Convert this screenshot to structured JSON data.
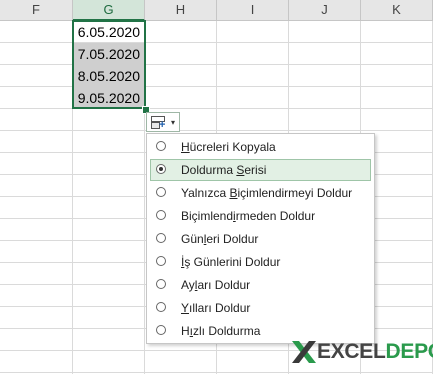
{
  "columns": [
    "F",
    "G",
    "H",
    "I",
    "J",
    "K"
  ],
  "cells": [
    {
      "value": "6.05.2020"
    },
    {
      "value": "7.05.2020"
    },
    {
      "value": "8.05.2020"
    },
    {
      "value": "9.05.2020"
    }
  ],
  "menu": {
    "items": [
      {
        "pre": "",
        "u": "H",
        "post": "ücreleri Kopyala",
        "checked": false
      },
      {
        "pre": "Doldurma ",
        "u": "S",
        "post": "erisi",
        "checked": true
      },
      {
        "pre": "Yalnızca ",
        "u": "B",
        "post": "içimlendirmeyi Doldur",
        "checked": false
      },
      {
        "pre": "Biçimlend",
        "u": "i",
        "post": "rmeden Doldur",
        "checked": false
      },
      {
        "pre": "Gün",
        "u": "l",
        "post": "eri Doldur",
        "checked": false
      },
      {
        "pre": "",
        "u": "İ",
        "post": "ş Günlerini Doldur",
        "checked": false
      },
      {
        "pre": "Ay",
        "u": "l",
        "post": "arı Doldur",
        "checked": false
      },
      {
        "pre": "",
        "u": "Y",
        "post": "ılları Doldur",
        "checked": false
      },
      {
        "pre": "H",
        "u": "ı",
        "post": "zlı Doldurma",
        "checked": false
      }
    ]
  },
  "autofill_button": {
    "icon": "autofill-options-icon",
    "caret": "▾"
  },
  "logo": {
    "part1": "EXCEL",
    "part2": "DEPO"
  },
  "colors": {
    "accent": "#217346",
    "logo_green": "#2a9a4c"
  }
}
